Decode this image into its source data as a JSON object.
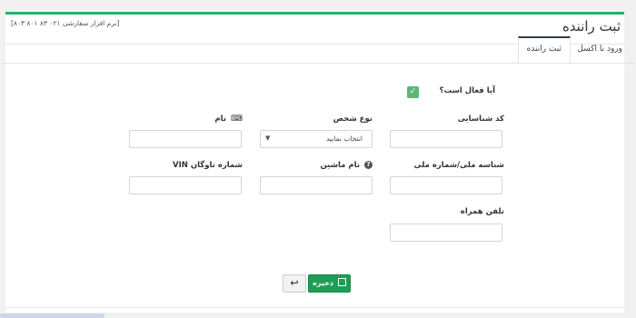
{
  "header": {
    "title": "ثبت راننده",
    "phone_note": "[نرم افزار سفارشی ۰۲۱ ۸۳ ۸۰۱ ۸۰۳]"
  },
  "tabs": [
    {
      "label": "ورود با اکسل",
      "active": false
    },
    {
      "label": "ثبت راننده",
      "active": true
    }
  ],
  "form": {
    "is_active_label": "آیا فعال است؟",
    "is_active_checked": true,
    "code_label": "کد شناسایی",
    "person_type_label": "نوع شخص",
    "person_type_selected": "انتخاب نمایید",
    "name_label": "نام",
    "national_id_label": "شناسه ملی/شماره ملی",
    "car_name_label": "نام ماشین",
    "vin_label": "شماره ناوگان VIN",
    "mobile_label": "تلفن همراه"
  },
  "buttons": {
    "save_label": "ذخیره",
    "back_icon": "↩"
  },
  "icons": {
    "keyboard": "⌨",
    "help": "?",
    "check": "✓",
    "caret": "▼"
  },
  "colors": {
    "accent": "#2bb06a",
    "save_button": "#1f9d55",
    "checkbox": "#5cb879"
  }
}
